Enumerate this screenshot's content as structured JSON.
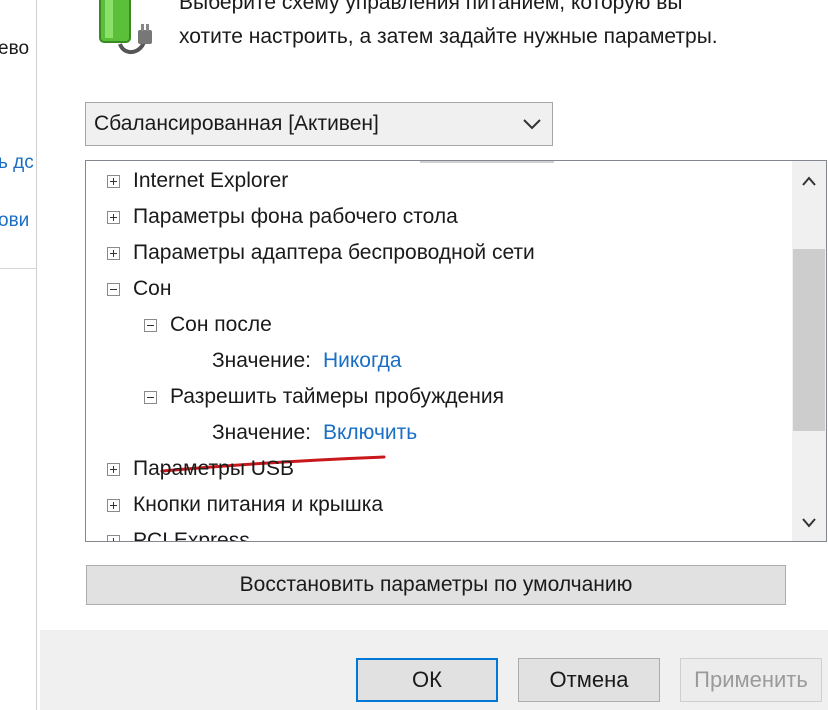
{
  "background_window": {
    "fragments": [
      "ево",
      "ь дс",
      "ови"
    ]
  },
  "header": {
    "line1": "Выберите схему управления питанием, которую вы",
    "line2": "хотите настроить, а затем задайте нужные параметры."
  },
  "scheme_select": {
    "value": "Сбалансированная [Активен]"
  },
  "tree": {
    "items": [
      {
        "label": "Internet Explorer",
        "state": "collapsed"
      },
      {
        "label": "Параметры фона рабочего стола",
        "state": "collapsed"
      },
      {
        "label": "Параметры адаптера беспроводной сети",
        "state": "collapsed"
      },
      {
        "label": "Сон",
        "state": "expanded"
      },
      {
        "label": "Сон после",
        "state": "expanded"
      },
      {
        "value_label": "Значение:",
        "value": "Никогда"
      },
      {
        "label": "Разрешить таймеры пробуждения",
        "state": "expanded"
      },
      {
        "value_label": "Значение:",
        "value": "Включить"
      },
      {
        "label": "Параметры USB",
        "state": "collapsed"
      },
      {
        "label": "Кнопки питания и крышка",
        "state": "collapsed"
      },
      {
        "label": "PCI Express",
        "state": "collapsed"
      }
    ]
  },
  "restore_button": {
    "label": "Восстановить параметры по умолчанию"
  },
  "buttons": {
    "ok": "ОК",
    "cancel": "Отмена",
    "apply": "Применить"
  },
  "colors": {
    "link": "#1a6fc4",
    "annotation_red": "#c8181b",
    "focus_border": "#0078d7"
  }
}
